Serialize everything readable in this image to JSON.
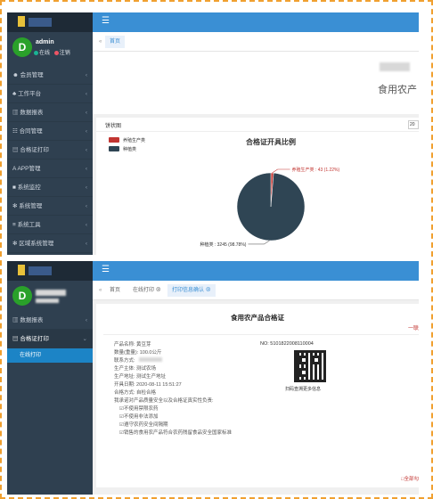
{
  "shot1": {
    "user": {
      "name": "admin",
      "online": "在线",
      "logout": "注销"
    },
    "menu": [
      {
        "icon": "user-icon",
        "label": "会员管理"
      },
      {
        "icon": "sitemap-icon",
        "label": "工作平台"
      },
      {
        "icon": "chart-icon",
        "label": "数据报表"
      },
      {
        "icon": "list-icon",
        "label": "合同管理"
      },
      {
        "icon": "print-icon",
        "label": "合格证打印"
      },
      {
        "icon": "app-icon",
        "label": "APP管理"
      },
      {
        "icon": "video-icon",
        "label": "系统监控"
      },
      {
        "icon": "gear-icon",
        "label": "系统管理"
      },
      {
        "icon": "tools-icon",
        "label": "系统工具"
      },
      {
        "icon": "gear-icon",
        "label": "区域系统管理"
      }
    ],
    "tab_home": "首页",
    "banner_text": "食用农产",
    "chart_panel_label": "饼状图",
    "chart_select": "20",
    "chart_data": {
      "type": "pie",
      "title": "合格证开具比例",
      "legend": [
        "养殖生产类",
        "种植类"
      ],
      "slices": [
        {
          "name": "养殖生产类",
          "value": 43,
          "percent": "1.22%",
          "color": "#c23531"
        },
        {
          "name": "种植类",
          "value": 3245,
          "percent": "98.78%",
          "color": "#2f4554"
        }
      ],
      "labels": [
        "养殖生产类 : 43 (1.22%)",
        "种植类 : 3245 (98.78%)"
      ]
    }
  },
  "shot2": {
    "menu": [
      {
        "icon": "chart-icon",
        "label": "数据报表"
      },
      {
        "icon": "print-icon",
        "label": "合格证打印"
      }
    ],
    "submenu": "在线打印",
    "tabs": [
      "首页",
      "在线打印",
      "打印信息确认"
    ],
    "cert": {
      "title": "食用农产品合格证",
      "right_tag": "一联",
      "no_label": "NO: 5101822008110004",
      "qr_caption": "扫码查溯更多信息",
      "lines": [
        "产品名称: 黄豆芽",
        "数量(重量): 100.0公斤",
        "联系方式:",
        "生产主体: 测试农场",
        "生产地址: 测试生产地址",
        "开具日期: 2020-08-11 15:51:27",
        "合格方式: 自检合格"
      ],
      "promise_title": "我承诺对产品质量安全以及合格证真实性负责:",
      "promises": [
        "不使用禁限农药",
        "不使用非法添加",
        "遵守农药安全间隔期",
        "销售的食用农产品符合农药残留食品安全国家标准"
      ],
      "bottom_link": "全部勾"
    }
  },
  "colors": {
    "sidebar": "#2f4050",
    "topbar": "#3a8fd4",
    "accent_red": "#c23531",
    "dark_slice": "#2f4554"
  }
}
